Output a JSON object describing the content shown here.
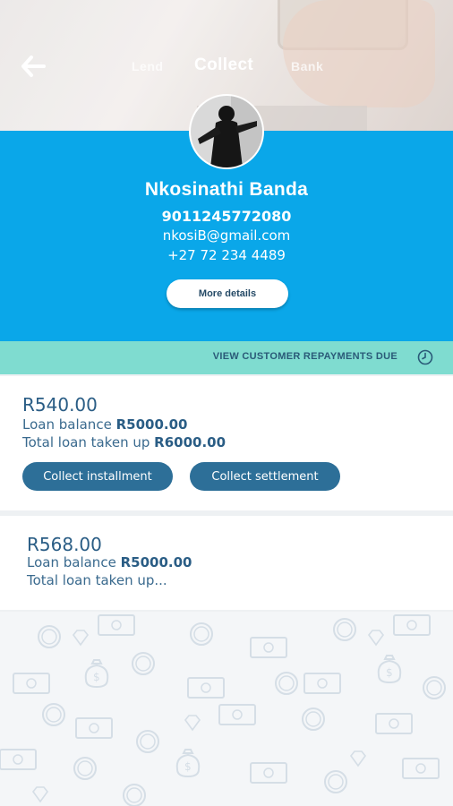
{
  "header": {
    "tabs": [
      {
        "label": "Lend"
      },
      {
        "label": "Collect"
      },
      {
        "label": "Bank"
      }
    ]
  },
  "profile": {
    "name": "Nkosinathi Banda",
    "id_number": "9011245772080",
    "email": "nkosiB@gmail.com",
    "phone": "+27 72 234 4489",
    "more_details_label": "More details"
  },
  "repayments_bar": {
    "label": "VIEW CUSTOMER REPAYMENTS DUE",
    "icon": "clock-icon"
  },
  "loans": [
    {
      "amount": "R540.00",
      "balance_label": "Loan balance",
      "balance_value": "R5000.00",
      "total_label": "Total loan taken up",
      "total_value": "R6000.00",
      "collect_installment_label": "Collect installment",
      "collect_settlement_label": "Collect settlement"
    },
    {
      "amount": "R568.00",
      "balance_label": "Loan balance",
      "balance_value": "R5000.00",
      "total_label": "Total loan taken up..."
    }
  ],
  "colors": {
    "primary_blue": "#0aa7e9",
    "mint": "#7fdcd0",
    "button_blue": "#2d6f98",
    "text_blue": "#2a5d85"
  }
}
